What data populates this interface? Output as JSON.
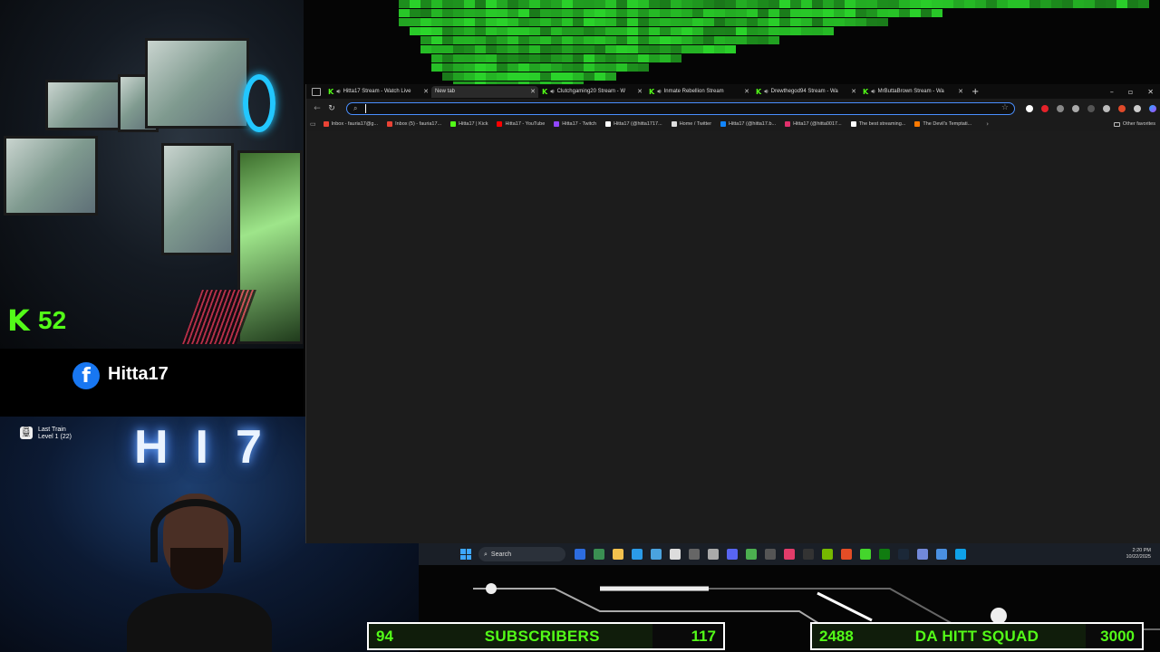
{
  "overlay": {
    "kick_count": "52",
    "facebook_name": "Hitta17",
    "neon_sign": "HI7",
    "achievement": {
      "game": "Last Train",
      "level": "Level 1 (22)"
    }
  },
  "browser": {
    "tabs": [
      {
        "label": "Hitta17 Stream - Watch Live",
        "icon": "kick",
        "active": false
      },
      {
        "label": "New tab",
        "icon": "blank",
        "active": true
      },
      {
        "label": "Clutchgaming20 Stream - W",
        "icon": "kick",
        "active": false
      },
      {
        "label": "Inmate Rebellion Stream",
        "icon": "kick",
        "active": false
      },
      {
        "label": "Drewthegod94 Stream - Wa",
        "icon": "kick",
        "active": false
      },
      {
        "label": "MrButtaBrown Stream - Wa",
        "icon": "kick",
        "active": false
      }
    ],
    "address_bar": {
      "value": "",
      "placeholder": ""
    },
    "bookmarks": [
      {
        "label": "Inbox - fauria17@g...",
        "color": "#ea4335"
      },
      {
        "label": "Inbox (5) - fauria17...",
        "color": "#ea4335"
      },
      {
        "label": "Hitta17 | Kick",
        "color": "#53fc18"
      },
      {
        "label": "Hitta17 - YouTube",
        "color": "#ff0000"
      },
      {
        "label": "Hitta17 - Twitch",
        "color": "#9146ff"
      },
      {
        "label": "Hitta17 (@hitta1717...",
        "color": "#ffffff"
      },
      {
        "label": "Home / Twitter",
        "color": "#dddddd"
      },
      {
        "label": "Hitta17 (@hitta17.b...",
        "color": "#1185fe"
      },
      {
        "label": "Hitta17 (@hitta0017...",
        "color": "#e1306c"
      },
      {
        "label": "The best streaming...",
        "color": "#ffffff"
      },
      {
        "label": "The Devil's Temptati...",
        "color": "#ff7a00"
      }
    ],
    "other_favorites": "Other favorites"
  },
  "taskbar": {
    "search_label": "Search",
    "time": "2:20 PM",
    "date": "10/22/2025",
    "apps": [
      "file-explorer",
      "terminal",
      "folder",
      "vscode",
      "mail",
      "capcut",
      "parsec",
      "steam-alt",
      "discord",
      "chrome",
      "obs",
      "itunes",
      "epic",
      "nvidia",
      "maps",
      "razer",
      "xbox",
      "steam",
      "discord-2",
      "notepad",
      "edge"
    ]
  },
  "goals": {
    "subscribers": {
      "current": "94",
      "label": "SUBSCRIBERS",
      "target": "117",
      "progress": 0.8
    },
    "squad": {
      "current": "2488",
      "label": "DA HITT SQUAD",
      "target": "3000",
      "progress": 0.83
    }
  },
  "colors": {
    "kick_green": "#53fc18",
    "facebook_blue": "#1877f2",
    "address_focus": "#4a8fff"
  }
}
